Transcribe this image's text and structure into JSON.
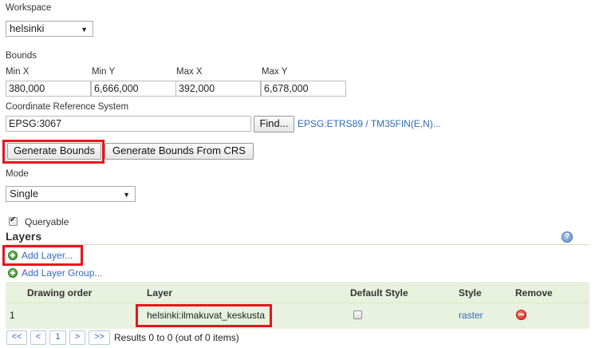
{
  "workspace": {
    "label": "Workspace",
    "value": "helsinki"
  },
  "bounds": {
    "label": "Bounds",
    "fields": [
      {
        "label": "Min X",
        "value": "380,000"
      },
      {
        "label": "Min Y",
        "value": "6,666,000"
      },
      {
        "label": "Max X",
        "value": "392,000"
      },
      {
        "label": "Max Y",
        "value": "6,678,000"
      }
    ]
  },
  "crs": {
    "label": "Coordinate Reference System",
    "value": "EPSG:3067",
    "find_label": "Find...",
    "description_link": "EPSG:ETRS89 / TM35FIN(E,N)..."
  },
  "buttons": {
    "generate_bounds": "Generate Bounds",
    "generate_bounds_from_crs": "Generate Bounds From CRS"
  },
  "mode": {
    "label": "Mode",
    "value": "Single"
  },
  "queryable": {
    "label": "Queryable",
    "checked": true
  },
  "layers": {
    "title": "Layers",
    "add_layer": "Add Layer...",
    "add_layer_group": "Add Layer Group...",
    "columns": [
      "Drawing order",
      "Layer",
      "Default Style",
      "Style",
      "Remove"
    ],
    "rows": [
      {
        "order": "1",
        "layer": "helsinki:ilmakuvat_keskusta",
        "default_style": false,
        "style": "raster"
      }
    ]
  },
  "pager": {
    "first": "<<",
    "prev": "<",
    "page": "1",
    "next": ">",
    "last": ">>",
    "results": "Results 0 to 0 (out of 0 items)"
  },
  "icons": {
    "help": "help-icon",
    "add": "plus-circle-icon",
    "remove": "remove-circle-icon"
  },
  "colors": {
    "highlight": "#e8141c",
    "link": "#2f6bb5",
    "table_bg": "#e9f2e0"
  }
}
